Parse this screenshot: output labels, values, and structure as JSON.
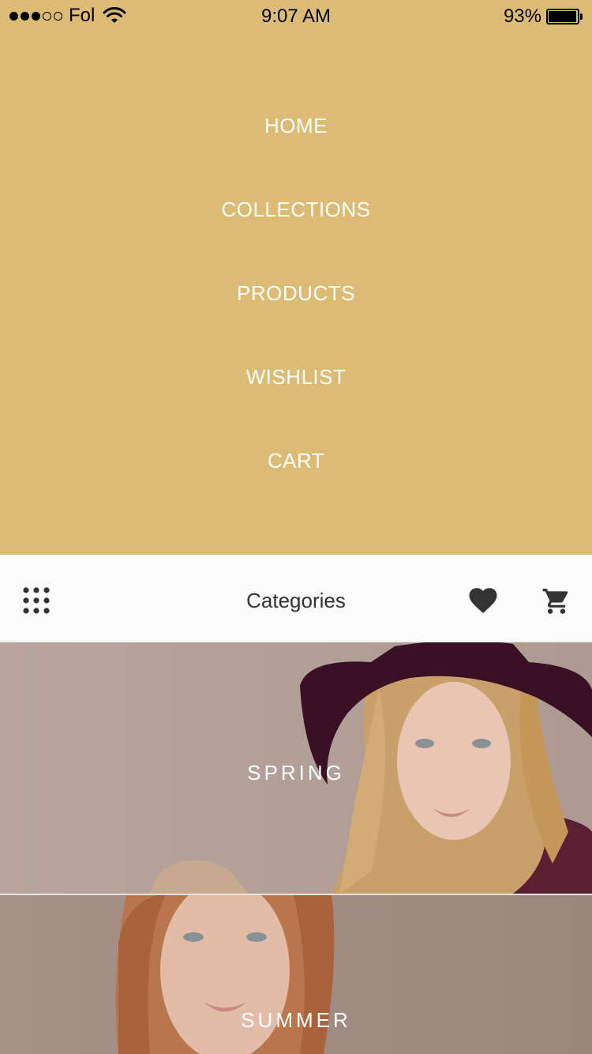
{
  "status_bar": {
    "carrier": "Fol",
    "time": "9:07 AM",
    "battery": "93%",
    "signal_bars_filled": 3,
    "signal_bars_total": 5
  },
  "menu": {
    "background_color": "#dcbb75",
    "items": [
      {
        "label": "HOME"
      },
      {
        "label": "COLLECTIONS"
      },
      {
        "label": "PRODUCTS"
      },
      {
        "label": "WISHLIST"
      },
      {
        "label": "CART"
      }
    ]
  },
  "toolbar": {
    "title": "Categories",
    "left_icon": "grid-icon",
    "right_icons": [
      "heart-icon",
      "cart-icon"
    ]
  },
  "categories": [
    {
      "label": "SPRING"
    },
    {
      "label": "SUMMER"
    }
  ]
}
